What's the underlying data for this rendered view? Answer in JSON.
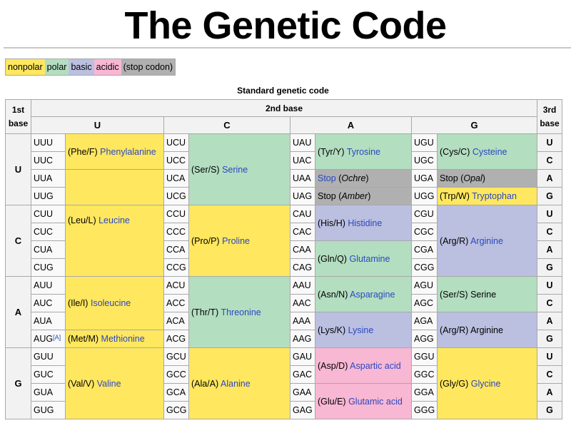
{
  "title": "The Genetic Code",
  "legend": [
    {
      "label": "nonpolar",
      "category": "nonpolar",
      "color": "#ffe75f"
    },
    {
      "label": "polar",
      "category": "polar",
      "color": "#b3dec0"
    },
    {
      "label": "basic",
      "category": "basic",
      "color": "#bbbfe0"
    },
    {
      "label": "acidic",
      "category": "acidic",
      "color": "#f8b7d3"
    },
    {
      "label": "(stop codon)",
      "category": "stop",
      "color": "#b0b0b0"
    }
  ],
  "table": {
    "caption": "Standard genetic code",
    "first_base_header": "1st base",
    "second_base_header": "2nd base",
    "third_base_header": "3rd base",
    "second_bases": [
      "U",
      "C",
      "A",
      "G"
    ],
    "blocks": [
      {
        "first": "U",
        "third": [
          "U",
          "C",
          "A",
          "G"
        ],
        "columns": [
          {
            "codons": [
              "UUU",
              "UUC",
              "UUA",
              "UUG"
            ],
            "amino": [
              {
                "rows": 2,
                "abbr": "(Phe/F)",
                "name": "Phenylalanine",
                "cat": "np",
                "link": true
              },
              {
                "rows": 2,
                "abbr": "",
                "name": "",
                "cat": "np",
                "link": false
              }
            ]
          },
          {
            "codons": [
              "UCU",
              "UCC",
              "UCA",
              "UCG"
            ],
            "amino": [
              {
                "rows": 4,
                "abbr": "(Ser/S)",
                "name": "Serine",
                "cat": "po",
                "link": true
              }
            ]
          },
          {
            "codons": [
              "UAU",
              "UAC",
              "UAA",
              "UAG"
            ],
            "amino": [
              {
                "rows": 2,
                "abbr": "(Tyr/Y)",
                "name": "Tyrosine",
                "cat": "po",
                "link": true
              },
              {
                "rows": 1,
                "abbr": "",
                "name": "Stop",
                "suffix": "Ochre",
                "cat": "st",
                "link": true
              },
              {
                "rows": 1,
                "abbr": "",
                "name": "Stop",
                "suffix": "Amber",
                "cat": "st",
                "link": false
              }
            ]
          },
          {
            "codons": [
              "UGU",
              "UGC",
              "UGA",
              "UGG"
            ],
            "amino": [
              {
                "rows": 2,
                "abbr": "(Cys/C)",
                "name": "Cysteine",
                "cat": "po",
                "link": true
              },
              {
                "rows": 1,
                "abbr": "",
                "name": "Stop",
                "suffix": "Opal",
                "cat": "st",
                "link": false
              },
              {
                "rows": 1,
                "abbr": "(Trp/W)",
                "name": "Tryptophan",
                "cat": "np",
                "link": true
              }
            ]
          }
        ]
      },
      {
        "first": "C",
        "third": [
          "U",
          "C",
          "A",
          "G"
        ],
        "columns": [
          {
            "codons": [
              "CUU",
              "CUC",
              "CUA",
              "CUG"
            ],
            "amino": [
              {
                "rows": 4,
                "abbr": "(Leu/L)",
                "name": "Leucine",
                "cat": "np",
                "link": true,
                "valign": "top"
              }
            ]
          },
          {
            "codons": [
              "CCU",
              "CCC",
              "CCA",
              "CCG"
            ],
            "amino": [
              {
                "rows": 4,
                "abbr": "(Pro/P)",
                "name": "Proline",
                "cat": "np",
                "link": true
              }
            ]
          },
          {
            "codons": [
              "CAU",
              "CAC",
              "CAA",
              "CAG"
            ],
            "amino": [
              {
                "rows": 2,
                "abbr": "(His/H)",
                "name": "Histidine",
                "cat": "ba",
                "link": true
              },
              {
                "rows": 2,
                "abbr": "(Gln/Q)",
                "name": "Glutamine",
                "cat": "po",
                "link": true
              }
            ]
          },
          {
            "codons": [
              "CGU",
              "CGC",
              "CGA",
              "CGG"
            ],
            "amino": [
              {
                "rows": 4,
                "abbr": "(Arg/R)",
                "name": "Arginine",
                "cat": "ba",
                "link": true
              }
            ]
          }
        ]
      },
      {
        "first": "A",
        "third": [
          "U",
          "C",
          "A",
          "G"
        ],
        "columns": [
          {
            "codons": [
              "AUU",
              "AUC",
              "AUA",
              "AUG"
            ],
            "codon_notes": {
              "3": "[A]"
            },
            "amino": [
              {
                "rows": 3,
                "abbr": "(Ile/I)",
                "name": "Isoleucine",
                "cat": "np",
                "link": true
              },
              {
                "rows": 1,
                "abbr": "(Met/M)",
                "name": "Methionine",
                "cat": "np",
                "link": true
              }
            ]
          },
          {
            "codons": [
              "ACU",
              "ACC",
              "ACA",
              "ACG"
            ],
            "amino": [
              {
                "rows": 4,
                "abbr": "(Thr/T)",
                "name": "Threonine",
                "cat": "po",
                "link": true
              }
            ]
          },
          {
            "codons": [
              "AAU",
              "AAC",
              "AAA",
              "AAG"
            ],
            "amino": [
              {
                "rows": 2,
                "abbr": "(Asn/N)",
                "name": "Asparagine",
                "cat": "po",
                "link": true
              },
              {
                "rows": 2,
                "abbr": "(Lys/K)",
                "name": "Lysine",
                "cat": "ba",
                "link": true
              }
            ]
          },
          {
            "codons": [
              "AGU",
              "AGC",
              "AGA",
              "AGG"
            ],
            "amino": [
              {
                "rows": 2,
                "abbr": "(Ser/S)",
                "name": "Serine",
                "cat": "po",
                "link": false
              },
              {
                "rows": 2,
                "abbr": "(Arg/R)",
                "name": "Arginine",
                "cat": "ba",
                "link": false
              }
            ]
          }
        ]
      },
      {
        "first": "G",
        "third": [
          "U",
          "C",
          "A",
          "G"
        ],
        "columns": [
          {
            "codons": [
              "GUU",
              "GUC",
              "GUA",
              "GUG"
            ],
            "amino": [
              {
                "rows": 4,
                "abbr": "(Val/V)",
                "name": "Valine",
                "cat": "np",
                "link": true
              }
            ]
          },
          {
            "codons": [
              "GCU",
              "GCC",
              "GCA",
              "GCG"
            ],
            "amino": [
              {
                "rows": 4,
                "abbr": "(Ala/A)",
                "name": "Alanine",
                "cat": "np",
                "link": true
              }
            ]
          },
          {
            "codons": [
              "GAU",
              "GAC",
              "GAA",
              "GAG"
            ],
            "amino": [
              {
                "rows": 2,
                "abbr": "(Asp/D)",
                "name": "Aspartic acid",
                "cat": "ac",
                "link": true
              },
              {
                "rows": 2,
                "abbr": "(Glu/E)",
                "name": "Glutamic acid",
                "cat": "ac",
                "link": true
              }
            ]
          },
          {
            "codons": [
              "GGU",
              "GGC",
              "GGA",
              "GGG"
            ],
            "amino": [
              {
                "rows": 4,
                "abbr": "(Gly/G)",
                "name": "Glycine",
                "cat": "np",
                "link": true
              }
            ]
          }
        ]
      }
    ]
  }
}
